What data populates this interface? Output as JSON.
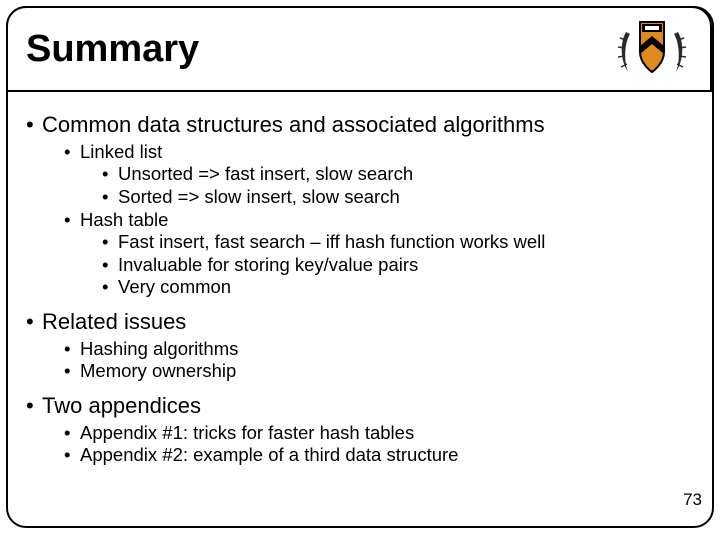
{
  "title": "Summary",
  "page_number": "73",
  "bullets": [
    {
      "level": 1,
      "text": "Common data structures and associated algorithms"
    },
    {
      "level": 2,
      "text": "Linked list"
    },
    {
      "level": 3,
      "text": "Unsorted => fast insert, slow search"
    },
    {
      "level": 3,
      "text": "Sorted => slow insert, slow search"
    },
    {
      "level": 2,
      "text": "Hash table"
    },
    {
      "level": 3,
      "text": "Fast insert, fast search – iff hash function works well"
    },
    {
      "level": 3,
      "text": "Invaluable for storing key/value pairs"
    },
    {
      "level": 3,
      "text": "Very common"
    },
    {
      "level": 1,
      "text": "Related issues"
    },
    {
      "level": 2,
      "text": "Hashing algorithms"
    },
    {
      "level": 2,
      "text": "Memory ownership"
    },
    {
      "level": 1,
      "text": "Two appendices"
    },
    {
      "level": 2,
      "text": "Appendix #1: tricks for faster hash tables"
    },
    {
      "level": 2,
      "text": "Appendix #2: example of a third data structure"
    }
  ]
}
